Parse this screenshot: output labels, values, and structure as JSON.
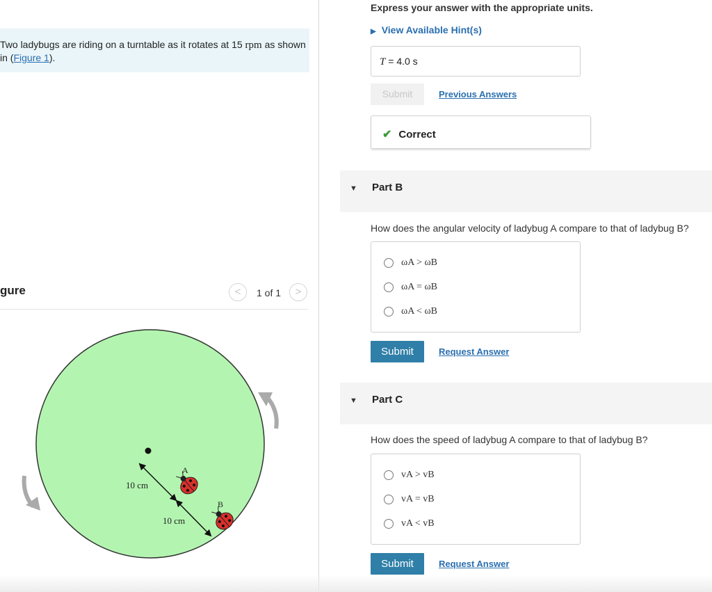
{
  "intro": {
    "text_before": "Two ladybugs are riding on a turntable as it rotates at 15 ",
    "rpm": "rpm",
    "text_middle": " as shown in (",
    "figure_link": "Figure 1",
    "text_after": ")."
  },
  "figure_panel": {
    "title": "gure",
    "pager_prev": "<",
    "pager_count": "1 of 1",
    "pager_next": ">",
    "label_a": "A",
    "label_b": "B",
    "dist_1": "10 cm",
    "dist_2": "10 cm",
    "colors": {
      "turntable": "#b3f5b0",
      "arrow": "#aaaaaa",
      "ladybug": "#d9302a"
    }
  },
  "part_a": {
    "units_note": "Express your answer with the appropriate units.",
    "hint": "View Available Hint(s)",
    "answer_var": "T",
    "answer_eq": " = ",
    "answer_value": "4.0 s",
    "submit": "Submit",
    "previous_answers": "Previous Answers",
    "feedback": "Correct"
  },
  "part_b": {
    "label": "Part B",
    "question": "How does the angular velocity of ladybug A compare to that of ladybug B?",
    "options": [
      "ωA > ωB",
      "ωA = ωB",
      "ωA < ωB"
    ],
    "submit": "Submit",
    "request_answer": "Request Answer"
  },
  "part_c": {
    "label": "Part C",
    "question": "How does the speed of ladybug A compare to that of ladybug B?",
    "options": [
      "vA > vB",
      "vA = vB",
      "vA < vB"
    ],
    "submit": "Submit",
    "request_answer": "Request Answer"
  }
}
